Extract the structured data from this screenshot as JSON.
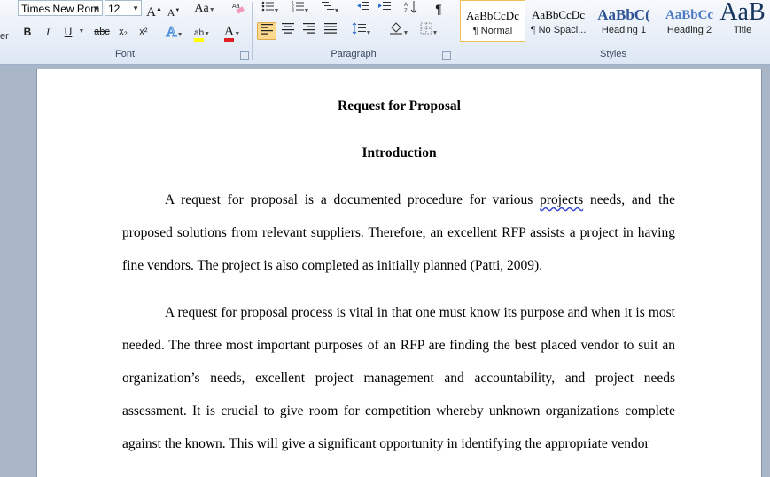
{
  "ribbon": {
    "font": {
      "name": "Times New Rom",
      "size": "12",
      "group_label": "Font",
      "buttons": [
        "B",
        "I",
        "U",
        "abc",
        "x₂",
        "x²"
      ]
    },
    "paragraph": {
      "group_label": "Paragraph",
      "pilcrow": "¶"
    },
    "styles": {
      "group_label": "Styles",
      "items": [
        {
          "preview": "AaBbCcDc",
          "name": "¶ Normal",
          "selected": true
        },
        {
          "preview": "AaBbCcDc",
          "name": "¶ No Spaci...",
          "selected": false
        },
        {
          "preview": "AaBbC(",
          "name": "Heading 1",
          "selected": false
        },
        {
          "preview": "AaBbCc",
          "name": "Heading 2",
          "selected": false
        },
        {
          "preview": "AaB",
          "name": "Title",
          "selected": false
        }
      ]
    },
    "left_edge_label": "er"
  },
  "document": {
    "title": "Request for Proposal",
    "section_heading": "Introduction",
    "paragraph1": {
      "before_error": "A request for proposal is a documented procedure for various ",
      "spelling_error": "projects",
      "after_error": " needs, and the proposed solutions from relevant suppliers.  Therefore, an excellent RFP assists a project in having fine vendors. The project is also completed as initially planned (Patti, 2009)."
    },
    "paragraph2": "A request for proposal process is vital in that one must know its purpose and when it is most needed.  The three most important purposes of an RFP are finding the best placed vendor to suit an organization’s needs, excellent project management and accountability, and project needs assessment.  It is crucial to give room for competition whereby unknown organizations complete against the known. This will give a significant opportunity in identifying the appropriate vendor"
  }
}
